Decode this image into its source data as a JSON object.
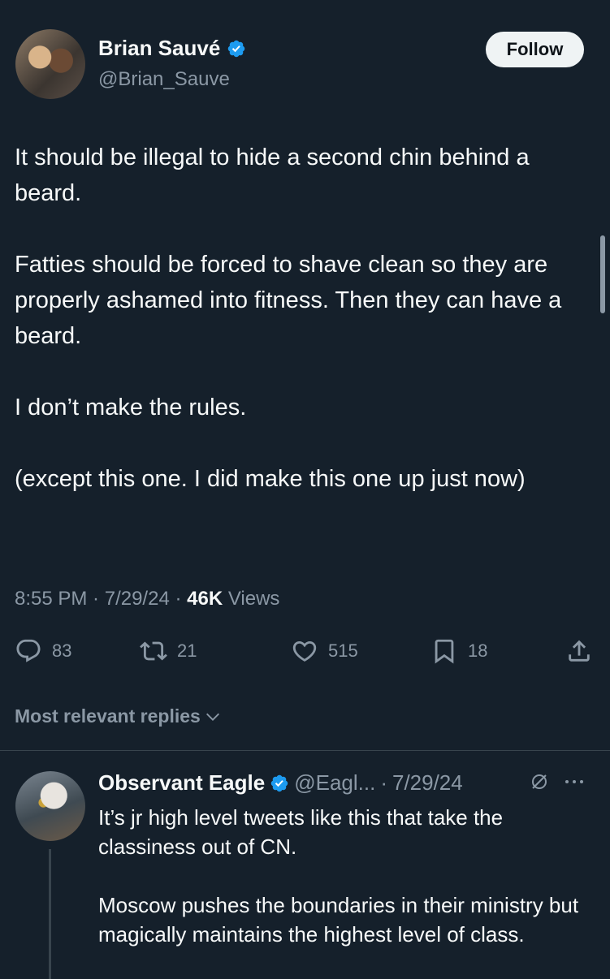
{
  "tweet": {
    "author_name": "Brian Sauvé",
    "author_handle": "@Brian_Sauve",
    "follow_label": "Follow",
    "paragraphs": [
      "It should be illegal to hide a second chin behind a beard.",
      "Fatties should be forced to shave clean so they are properly ashamed into fitness. Then they can have a beard.",
      "I don’t make the rules.",
      "(except this one. I did make this one up just now)"
    ],
    "time": "8:55 PM",
    "date": "7/29/24",
    "views_count": "46K",
    "views_label": "Views"
  },
  "actions": {
    "replies": "83",
    "reposts": "21",
    "likes": "515",
    "bookmarks": "18"
  },
  "replies_section": {
    "sort_label": "Most relevant replies"
  },
  "reply": {
    "author_name": "Observant Eagle",
    "author_handle": "@Eagl...",
    "date": "7/29/24",
    "paragraphs": [
      "It’s jr high level tweets like this that take the classiness out of CN.",
      "Moscow pushes the boundaries in their ministry but magically maintains the highest level of class."
    ]
  },
  "colors": {
    "background": "#15202b",
    "text": "#f7f9f9",
    "muted": "#8b98a5",
    "verified": "#1d9bf0"
  }
}
